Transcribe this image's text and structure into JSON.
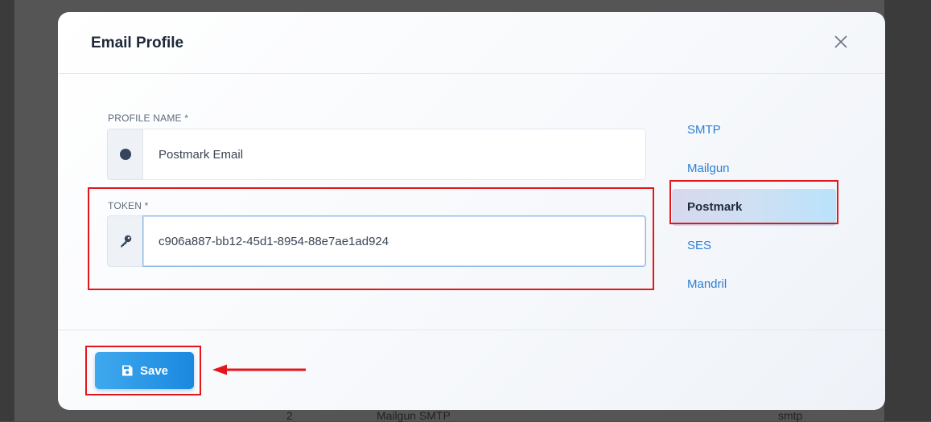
{
  "modal": {
    "title": "Email Profile",
    "close_icon": "close-icon"
  },
  "form": {
    "profile_name": {
      "label": "PROFILE NAME *",
      "value": "Postmark Email",
      "icon": "circle-icon"
    },
    "token": {
      "label": "TOKEN *",
      "value": "c906a887-bb12-45d1-8954-88e7ae1ad924",
      "icon": "key-icon"
    }
  },
  "providers": {
    "items": [
      {
        "label": "SMTP"
      },
      {
        "label": "Mailgun"
      },
      {
        "label": "Postmark"
      },
      {
        "label": "SES"
      },
      {
        "label": "Mandril"
      }
    ],
    "selected": "Postmark"
  },
  "footer": {
    "save_label": "Save",
    "save_icon": "floppy-disk-icon"
  },
  "background_table": {
    "row": [
      "2",
      "Mailgun SMTP",
      "smtp"
    ]
  },
  "colors": {
    "accent": "#1a88e0",
    "link": "#2a7fd4",
    "highlight": "#e3161b"
  }
}
